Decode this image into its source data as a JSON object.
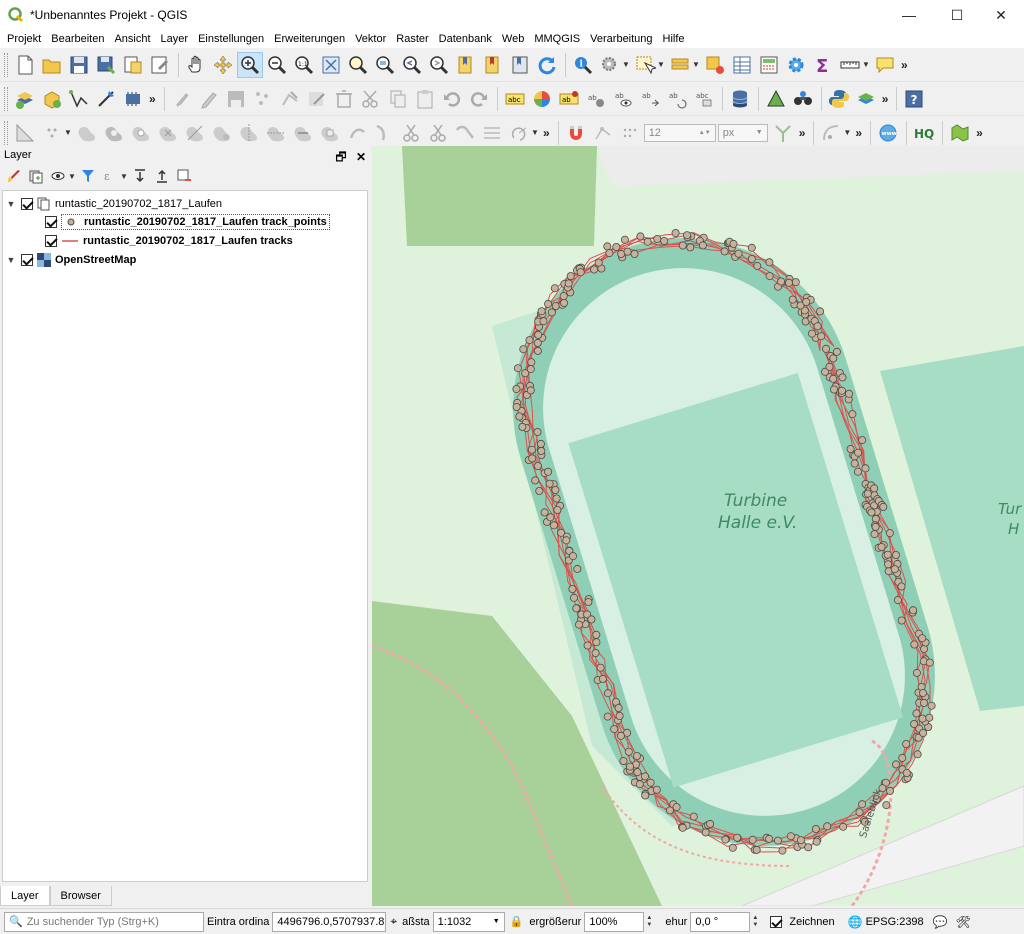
{
  "window": {
    "title": "*Unbenanntes Projekt - QGIS",
    "minimize_label": "—",
    "maximize_label": "☐",
    "close_label": "✕"
  },
  "menu": [
    "Projekt",
    "Bearbeiten",
    "Ansicht",
    "Layer",
    "Einstellungen",
    "Erweiterungen",
    "Vektor",
    "Raster",
    "Datenbank",
    "Web",
    "MMQGIS",
    "Verarbeitung",
    "Hilfe"
  ],
  "toolbar3": {
    "snap_tolerance": "12",
    "snap_unit": "px"
  },
  "more_label": "»",
  "layer_panel": {
    "title": "Layer",
    "group": "runtastic_20190702_1817_Laufen",
    "layer_points": "runtastic_20190702_1817_Laufen track_points",
    "layer_tracks": "runtastic_20190702_1817_Laufen tracks",
    "layer_osm": "OpenStreetMap",
    "tab_layer": "Layer",
    "tab_browser": "Browser"
  },
  "map": {
    "label_line1": "Turbine",
    "label_line2": "Halle e.V.",
    "label_edge1": "Tur",
    "label_edge2": "H",
    "street": "Saaleblick",
    "colors": {
      "grass": "#dff2dc",
      "park": "#c8e9c1",
      "forest": "#a8d19a",
      "pitch": "#a7dcc5",
      "track_ring": "#8fcfb5",
      "track_line": "#d9534f",
      "point_fill": "#c8b39a",
      "point_stroke": "#4a4a4a"
    }
  },
  "status": {
    "search_placeholder": "Zu suchender Typ (Strg+K)",
    "coord_label": "Eintra  ordina",
    "coord_value": "4496796.0,5707937.8",
    "scale_label": "aßsta",
    "scale_value": "1:1032",
    "magnifier_label": "ergrößerur",
    "magnifier_value": "100%",
    "rotation_label": "ehur",
    "rotation_value": "0,0 °",
    "render_label": "Zeichnen",
    "crs_label": "EPSG:2398"
  }
}
